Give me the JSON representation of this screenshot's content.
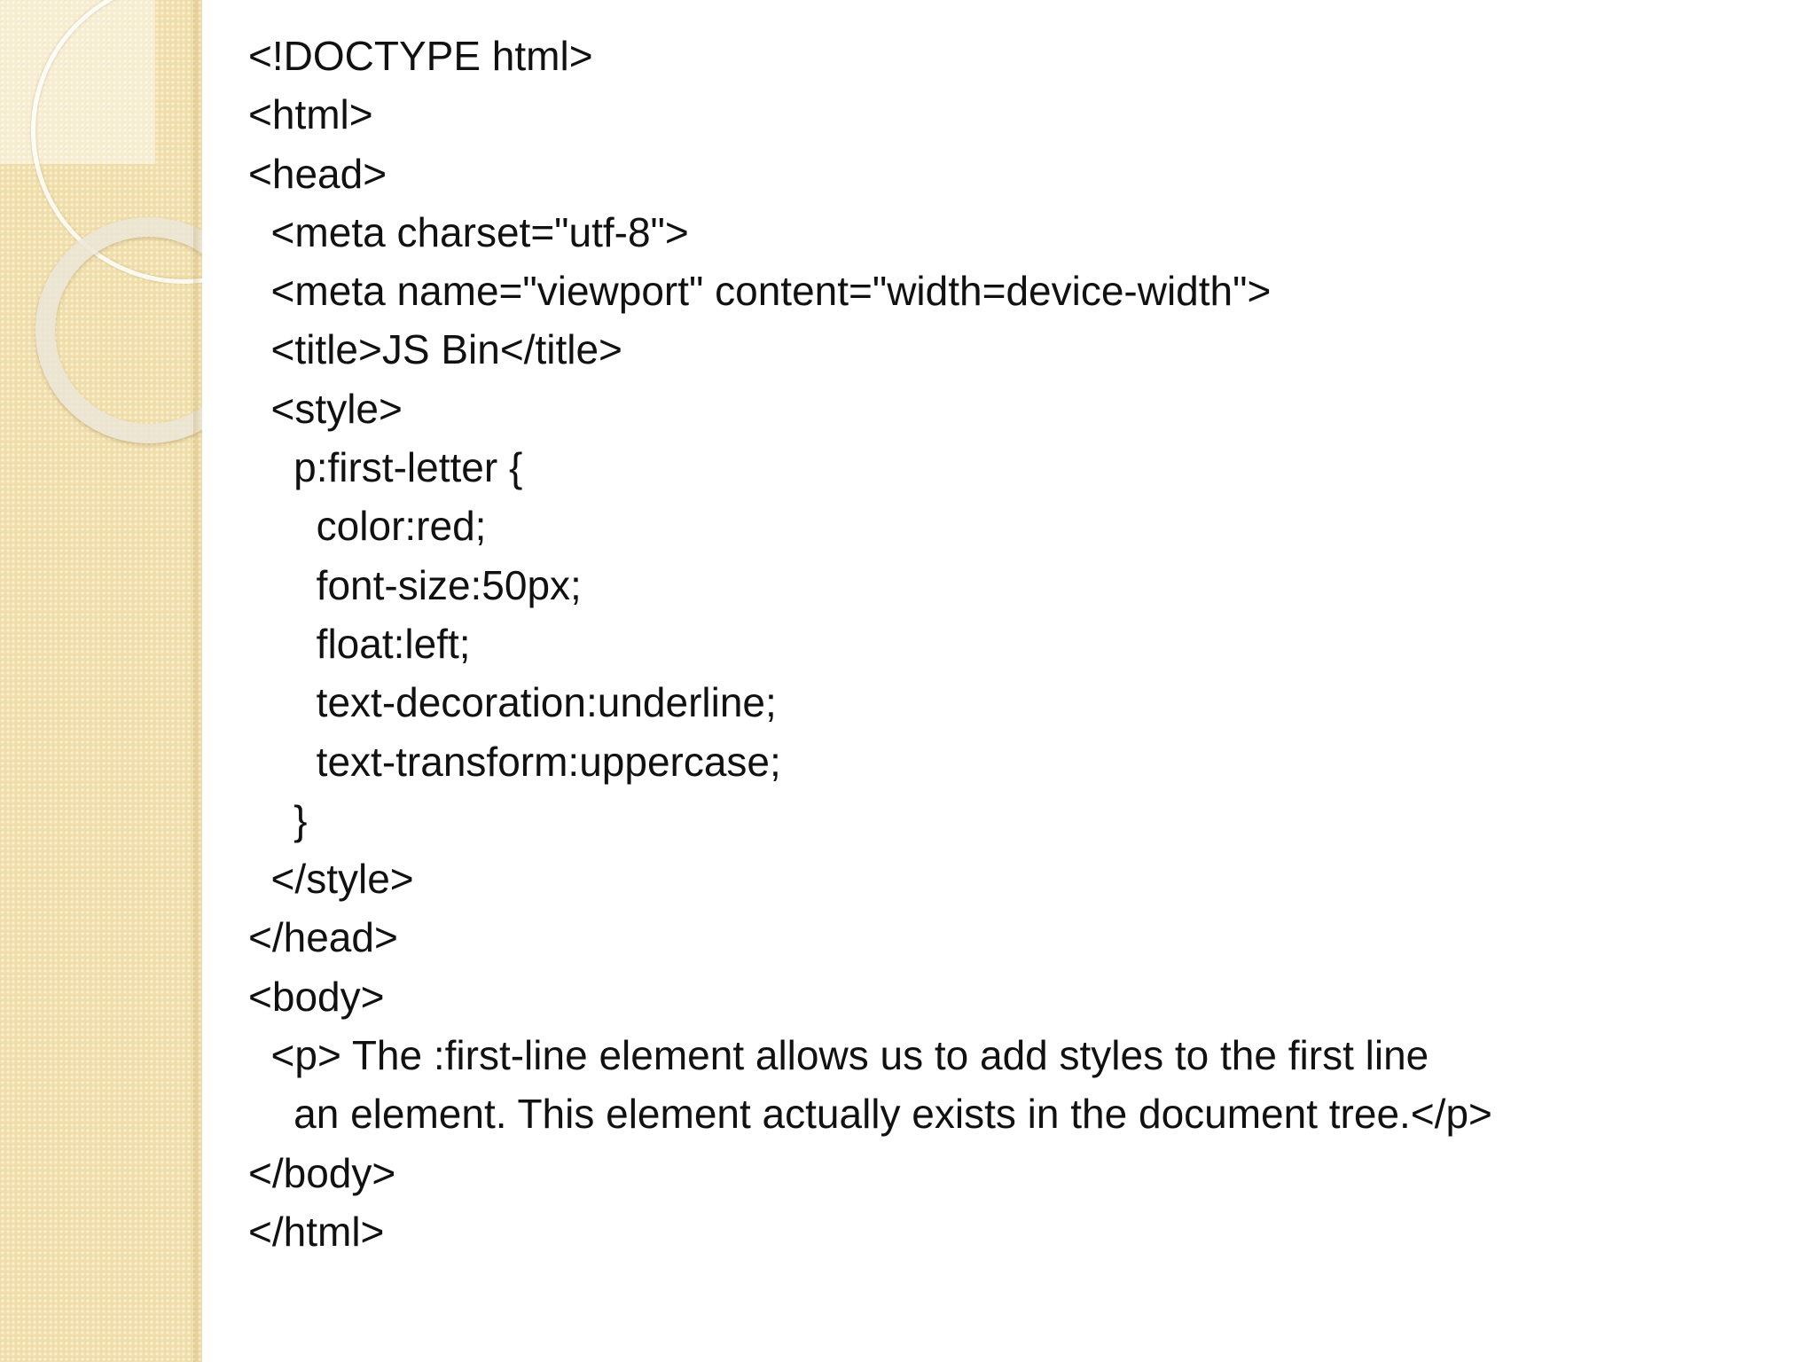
{
  "slide": {
    "code_lines": [
      "<!DOCTYPE html>",
      "<html>",
      "<head>",
      "  <meta charset=\"utf-8\">",
      "  <meta name=\"viewport\" content=\"width=device-width\">",
      "  <title>JS Bin</title>",
      "  <style>",
      "    p:first-letter {",
      "      color:red;",
      "      font-size:50px;",
      "      float:left;",
      "      text-decoration:underline;",
      "      text-transform:uppercase;",
      "    }",
      "  </style>",
      "</head>",
      "<body>",
      "  <p> The :first-line element allows us to add styles to the first line",
      "    an element. This element actually exists in the document tree.</p>",
      "</body>",
      "</html>"
    ]
  }
}
